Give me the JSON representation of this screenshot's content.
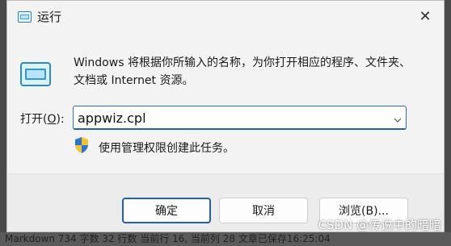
{
  "window": {
    "title": "运行",
    "close_glyph": "✕"
  },
  "description": "Windows 将根据你所输入的名称，为你打开相应的程序、文件夹、文档或 Internet 资源。",
  "open_field": {
    "label_prefix": "打开(",
    "label_accel": "O",
    "label_suffix": "):",
    "value": "appwiz.cpl"
  },
  "admin_note": "使用管理权限创建此任务。",
  "buttons": {
    "ok": "确定",
    "cancel": "取消",
    "browse": "浏览(B)..."
  },
  "statusbar": {
    "text": "Markdown  734 字数  32 行数  当前行 16, 当前列 28  文章已保存16:25:04"
  },
  "watermark": "CSDN @传说中的暗暗",
  "icons": {
    "title": "run-dialog-icon",
    "large": "run-dialog-icon",
    "shield": "uac-shield-icon",
    "dropdown": "chevron-down-icon"
  },
  "colors": {
    "accent": "#1f5fb5",
    "dialog_bg": "#f3f3f3",
    "footer_bg": "#ececec"
  }
}
